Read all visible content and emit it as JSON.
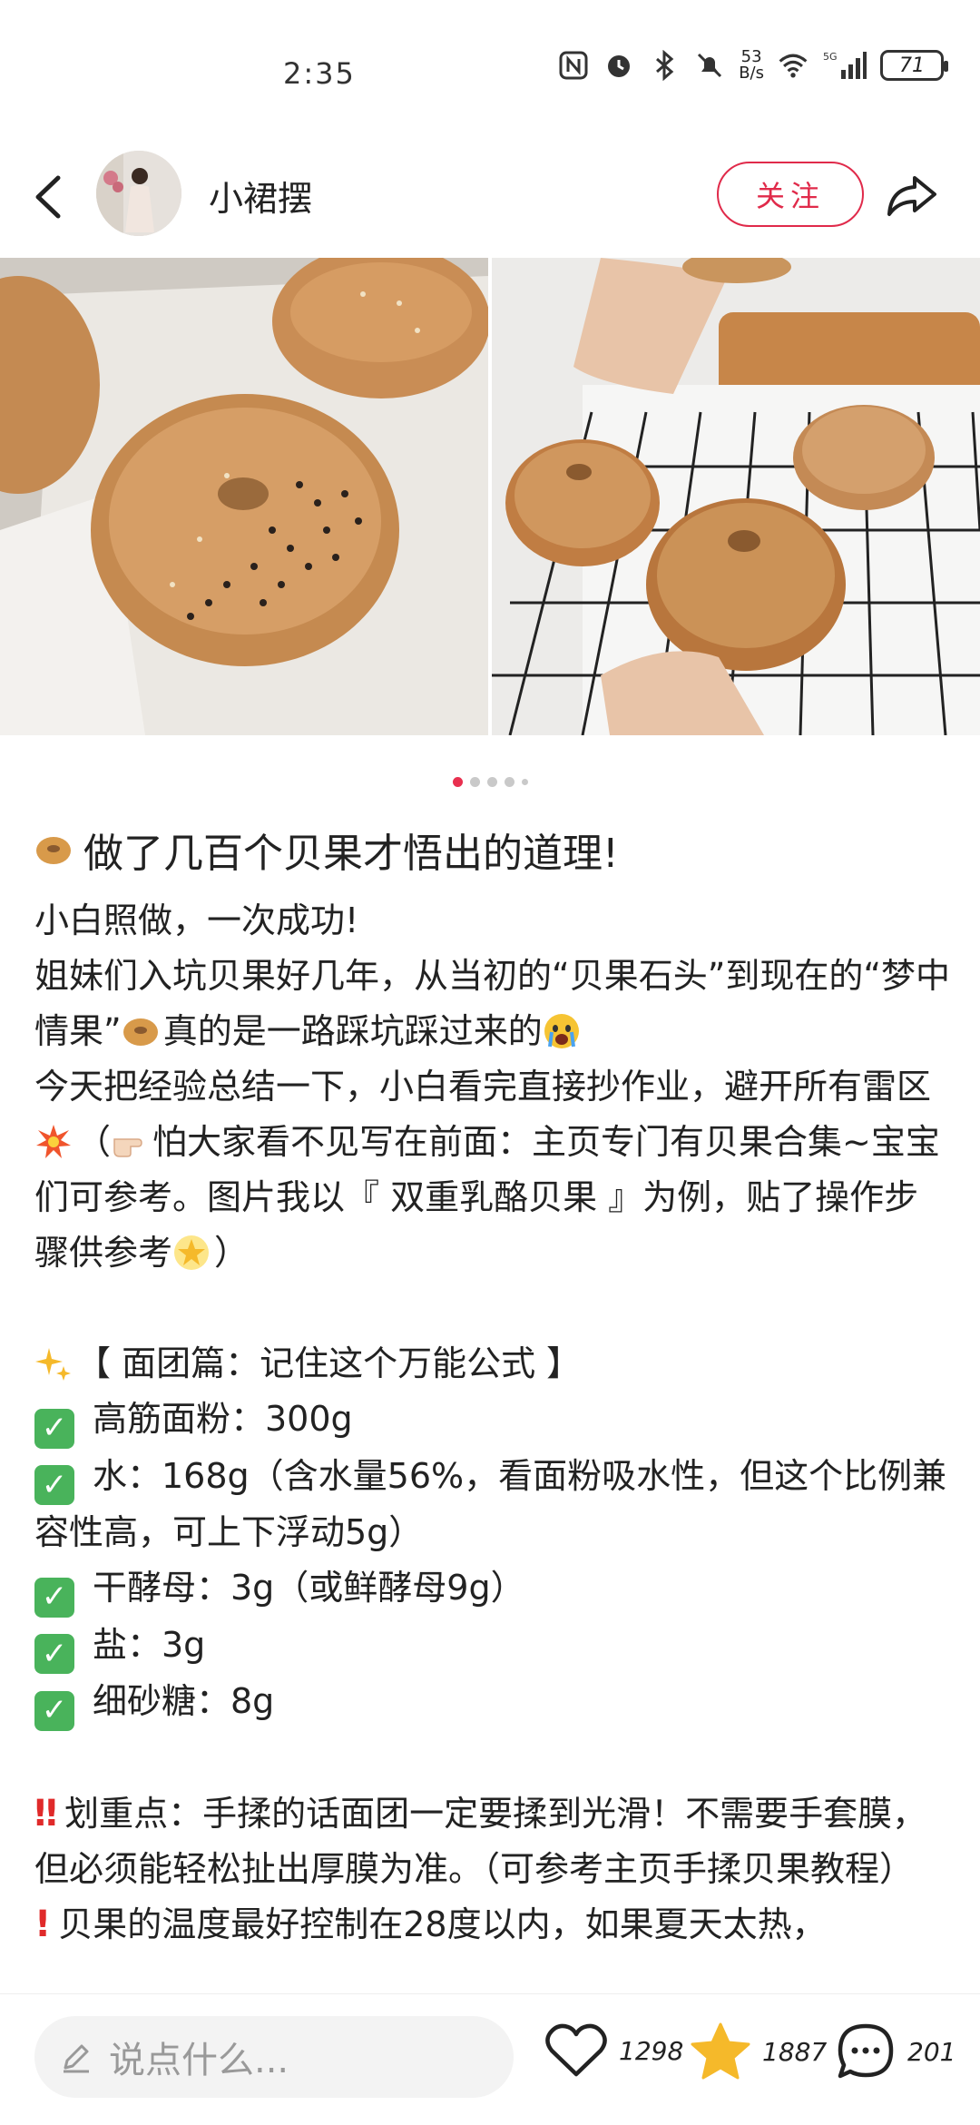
{
  "status": {
    "time": "2:35",
    "net_speed_top": "53",
    "net_speed_bottom": "B/s",
    "battery": "71"
  },
  "header": {
    "username": "小裙摆",
    "follow_label": "关注"
  },
  "post": {
    "title": "做了几百个贝果才悟出的道理!",
    "lines": {
      "l1": "小白照做，一次成功!",
      "l2": "姐妹们入坑贝果好几年，从当初的“贝果石头”到现在的“梦中情果”",
      "l2b": "真的是一路踩坑踩过来的",
      "l3": "今天把经验总结一下，小白看完直接抄作业，避开所有雷区",
      "l3b": "（",
      "l3c": "怕大家看不见写在前面：主页专门有贝果合集~宝宝们可参考。图片我以『 双重乳酪贝果 』为例，贴了操作步骤供参考",
      "l3d": "）",
      "section": "【 面团篇：记住这个万能公式 】",
      "i1": "高筋面粉：300g",
      "i2": "水：168g（含水量56%，看面粉吸水性，但这个比例兼容性高，可上下浮动5g）",
      "i3": "干酵母：3g（或鲜酵母9g）",
      "i4": "盐：3g",
      "i5": "细砂糖：8g",
      "k1": "划重点：手揉的话面团一定要揉到光滑！不需要手套膜，但必须能轻松扯出厚膜为准。（可参考主页手揉贝果教程）",
      "k2": "贝果的温度最好控制在28度以内，如果夏天太热，"
    }
  },
  "carousel": {
    "count": 5,
    "active_index": 0
  },
  "bottom": {
    "comment_placeholder": "说点什么...",
    "likes": "1298",
    "stars": "1887",
    "comments": "201"
  },
  "colors": {
    "accent": "#e02a4a",
    "check_green": "#49b35b",
    "star_yellow": "#f5b92a"
  },
  "icons": [
    "back-icon",
    "share-icon",
    "heart-icon",
    "star-icon",
    "comment-icon",
    "pen-icon"
  ]
}
